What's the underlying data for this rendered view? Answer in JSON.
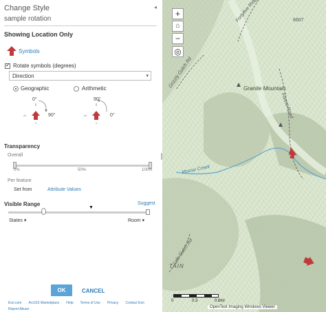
{
  "panel": {
    "collapse_glyph": "◂",
    "title": "Change Style",
    "layer_name": "sample rotation",
    "subtitle": "Showing Location Only",
    "symbols_label": "Symbols",
    "rotate_label": "Rotate symbols (degrees)",
    "rotate_checked": true,
    "direction_field": "Direction",
    "rotation_types": [
      {
        "label": "Geographic",
        "selected": true
      },
      {
        "label": "Arithmetic",
        "selected": false
      }
    ],
    "geo_diagram": {
      "top": "0°",
      "right": "90°"
    },
    "ari_diagram": {
      "top": "90°",
      "right": "0°"
    },
    "transparency": {
      "title": "Transparency",
      "overall_label": "Overall",
      "ticks": [
        "0%",
        "50%",
        "100%"
      ],
      "per_feature_label": "Per feature",
      "set_from_label": "Set from",
      "attribute_values_link": "Attribute Values"
    },
    "visible_range": {
      "title": "Visible Range",
      "suggest_link": "Suggest",
      "min_label": "States",
      "max_label": "Room"
    },
    "ok_label": "OK",
    "cancel_label": "CANCEL",
    "footer_links": [
      "Esri.com",
      "ArcGIS Marketplace",
      "Help",
      "Terms of Use",
      "Privacy",
      "Contact Esri"
    ],
    "report_abuse": "Report Abuse",
    "accent_color": "#2b7ab8",
    "arrow_color": "#c0393b"
  },
  "map": {
    "zoom_in": "+",
    "zoom_out": "−",
    "home_glyph": "⌂",
    "locate_glyph": "◎",
    "labels": {
      "mountain": "Granite Mountain",
      "creek": "Moose Creek",
      "road": "Forest Road",
      "gulch_top": "Grizzly Gulch Rd",
      "gulch_bottom": "Lyle Gulch Rd",
      "ridge": "Fortyfive Ridge",
      "peak": "6607",
      "tain": "TAIN"
    },
    "scale": [
      "0",
      "0.3",
      "0.6mi"
    ],
    "attribution": "OpenText Imaging Windows Viewer"
  }
}
